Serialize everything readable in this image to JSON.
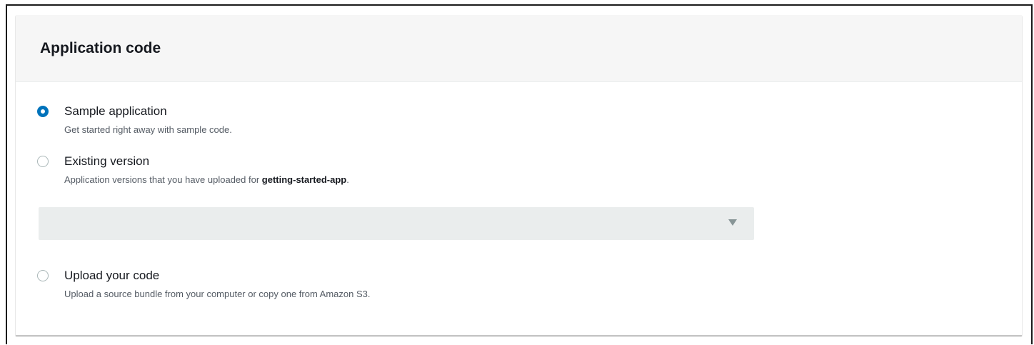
{
  "panel": {
    "title": "Application code"
  },
  "options": [
    {
      "label": "Sample application",
      "description": "Get started right away with sample code.",
      "checked": true
    },
    {
      "label": "Existing version",
      "description_prefix": "Application versions that you have uploaded for ",
      "description_app": "getting-started-app",
      "description_suffix": ".",
      "checked": false
    },
    {
      "label": "Upload your code",
      "description": "Upload a source bundle from your computer or copy one from Amazon S3.",
      "checked": false
    }
  ],
  "version_select": {
    "value": "",
    "disabled": true,
    "icon": "caret-down-icon"
  },
  "colors": {
    "accent": "#0073bb",
    "header_bg": "#f6f6f6",
    "select_bg": "#eaeded"
  }
}
